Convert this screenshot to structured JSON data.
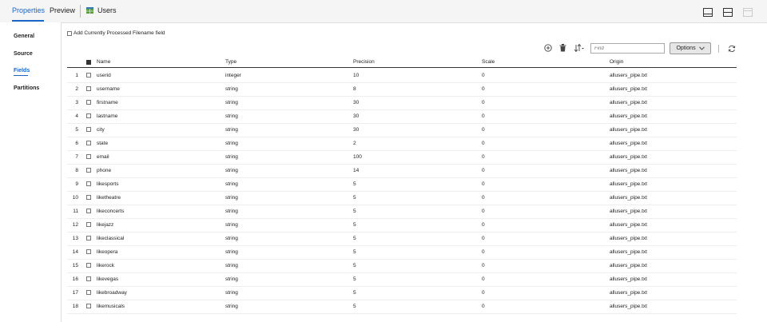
{
  "tabs": {
    "properties": "Properties",
    "preview": "Preview",
    "users": "Users"
  },
  "nav": {
    "general": "General",
    "source": "Source",
    "fields": "Fields",
    "partitions": "Partitions"
  },
  "filename_option": "Add Currently Processed Filename field",
  "toolbar": {
    "find_placeholder": "Find",
    "options_label": "Options"
  },
  "columns": {
    "name": "Name",
    "type": "Type",
    "precision": "Precision",
    "scale": "Scale",
    "origin": "Origin"
  },
  "rows": [
    {
      "n": "1",
      "name": "userid",
      "type": "integer",
      "precision": "10",
      "scale": "0",
      "origin": "allusers_pipe.txt"
    },
    {
      "n": "2",
      "name": "username",
      "type": "string",
      "precision": "8",
      "scale": "0",
      "origin": "allusers_pipe.txt"
    },
    {
      "n": "3",
      "name": "firstname",
      "type": "string",
      "precision": "30",
      "scale": "0",
      "origin": "allusers_pipe.txt"
    },
    {
      "n": "4",
      "name": "lastname",
      "type": "string",
      "precision": "30",
      "scale": "0",
      "origin": "allusers_pipe.txt"
    },
    {
      "n": "5",
      "name": "city",
      "type": "string",
      "precision": "30",
      "scale": "0",
      "origin": "allusers_pipe.txt"
    },
    {
      "n": "6",
      "name": "state",
      "type": "string",
      "precision": "2",
      "scale": "0",
      "origin": "allusers_pipe.txt"
    },
    {
      "n": "7",
      "name": "email",
      "type": "string",
      "precision": "100",
      "scale": "0",
      "origin": "allusers_pipe.txt"
    },
    {
      "n": "8",
      "name": "phone",
      "type": "string",
      "precision": "14",
      "scale": "0",
      "origin": "allusers_pipe.txt"
    },
    {
      "n": "9",
      "name": "likesports",
      "type": "string",
      "precision": "5",
      "scale": "0",
      "origin": "allusers_pipe.txt"
    },
    {
      "n": "10",
      "name": "liketheatre",
      "type": "string",
      "precision": "5",
      "scale": "0",
      "origin": "allusers_pipe.txt"
    },
    {
      "n": "11",
      "name": "likeconcerts",
      "type": "string",
      "precision": "5",
      "scale": "0",
      "origin": "allusers_pipe.txt"
    },
    {
      "n": "12",
      "name": "likejazz",
      "type": "string",
      "precision": "5",
      "scale": "0",
      "origin": "allusers_pipe.txt"
    },
    {
      "n": "13",
      "name": "likeclassical",
      "type": "string",
      "precision": "5",
      "scale": "0",
      "origin": "allusers_pipe.txt"
    },
    {
      "n": "14",
      "name": "likeopera",
      "type": "string",
      "precision": "5",
      "scale": "0",
      "origin": "allusers_pipe.txt"
    },
    {
      "n": "15",
      "name": "likerock",
      "type": "string",
      "precision": "5",
      "scale": "0",
      "origin": "allusers_pipe.txt"
    },
    {
      "n": "16",
      "name": "likevegas",
      "type": "string",
      "precision": "5",
      "scale": "0",
      "origin": "allusers_pipe.txt"
    },
    {
      "n": "17",
      "name": "likebroadway",
      "type": "string",
      "precision": "5",
      "scale": "0",
      "origin": "allusers_pipe.txt"
    },
    {
      "n": "18",
      "name": "likemusicals",
      "type": "string",
      "precision": "5",
      "scale": "0",
      "origin": "allusers_pipe.txt"
    }
  ]
}
